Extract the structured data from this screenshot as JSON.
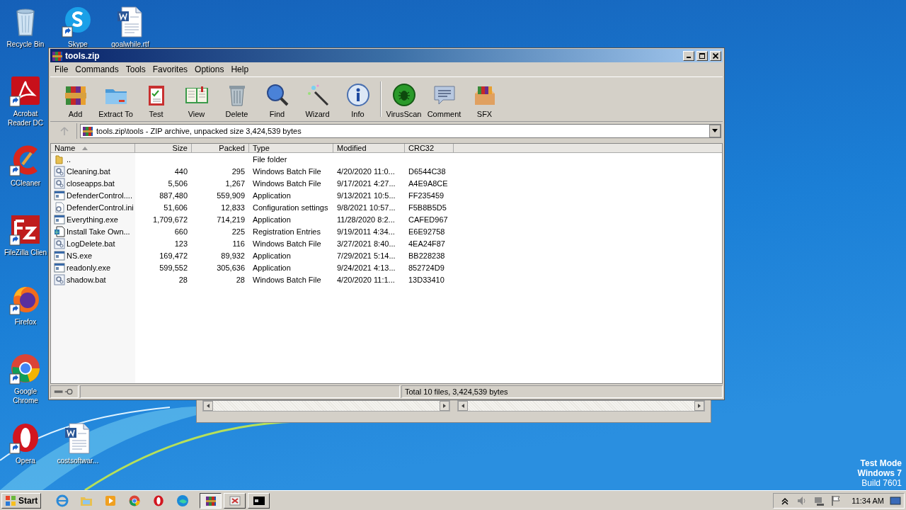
{
  "desktop": {
    "icons": [
      {
        "label": "Recycle Bin",
        "kind": "recycle",
        "shortcut": false
      },
      {
        "label": "Skype",
        "kind": "skype",
        "shortcut": true
      },
      {
        "label": "goalwhile.rtf",
        "kind": "word",
        "shortcut": false
      },
      {
        "label": "Acrobat Reader DC",
        "kind": "acrobat",
        "shortcut": true
      },
      {
        "label": "CCleaner",
        "kind": "ccleaner",
        "shortcut": true
      },
      {
        "label": "FileZilla Clien",
        "kind": "filezilla",
        "shortcut": true
      },
      {
        "label": "Firefox",
        "kind": "firefox",
        "shortcut": true
      },
      {
        "label": "Google Chrome",
        "kind": "chrome",
        "shortcut": true
      },
      {
        "label": "Opera",
        "kind": "opera",
        "shortcut": true
      },
      {
        "label": "costsoftwar...",
        "kind": "word",
        "shortcut": false
      }
    ],
    "notice": [
      "Test Mode",
      "Windows 7",
      "Build 7601"
    ]
  },
  "window": {
    "title": "tools.zip",
    "menu": [
      "File",
      "Commands",
      "Tools",
      "Favorites",
      "Options",
      "Help"
    ],
    "toolbar": {
      "groups": [
        [
          {
            "label": "Add",
            "kind": "add"
          },
          {
            "label": "Extract To",
            "kind": "extract"
          },
          {
            "label": "Test",
            "kind": "test"
          },
          {
            "label": "View",
            "kind": "view"
          },
          {
            "label": "Delete",
            "kind": "delete"
          },
          {
            "label": "Find",
            "kind": "find"
          },
          {
            "label": "Wizard",
            "kind": "wizard"
          },
          {
            "label": "Info",
            "kind": "info"
          }
        ],
        [
          {
            "label": "VirusScan",
            "kind": "virus"
          },
          {
            "label": "Comment",
            "kind": "comment"
          },
          {
            "label": "SFX",
            "kind": "sfx"
          }
        ]
      ]
    },
    "address": {
      "up_disabled": true,
      "value": "tools.zip\\tools - ZIP archive, unpacked size 3,424,539 bytes"
    },
    "table": {
      "columns": [
        {
          "label": "Name",
          "sorted": true
        },
        {
          "label": "Size",
          "sorted": false
        },
        {
          "label": "Packed",
          "sorted": false
        },
        {
          "label": "Type",
          "sorted": false
        },
        {
          "label": "Modified",
          "sorted": false
        },
        {
          "label": "CRC32",
          "sorted": false
        }
      ],
      "rows": [
        {
          "kind": "folder",
          "cells": [
            "..",
            "",
            "",
            "File folder",
            "",
            ""
          ]
        },
        {
          "kind": "bat",
          "cells": [
            "Cleaning.bat",
            "440",
            "295",
            "Windows Batch File",
            "4/20/2020 11:0...",
            "D6544C38"
          ]
        },
        {
          "kind": "bat",
          "cells": [
            "closeapps.bat",
            "5,506",
            "1,267",
            "Windows Batch File",
            "9/17/2021 4:27...",
            "A4E9A8CE"
          ]
        },
        {
          "kind": "exe",
          "cells": [
            "DefenderControl....",
            "887,480",
            "559,909",
            "Application",
            "9/13/2021 10:5...",
            "FF235459"
          ]
        },
        {
          "kind": "ini",
          "cells": [
            "DefenderControl.ini",
            "51,606",
            "12,833",
            "Configuration settings",
            "9/8/2021 10:57...",
            "F5B8B5D5"
          ]
        },
        {
          "kind": "exe",
          "cells": [
            "Everything.exe",
            "1,709,672",
            "714,219",
            "Application",
            "11/28/2020 8:2...",
            "CAFED967"
          ]
        },
        {
          "kind": "reg",
          "cells": [
            "Install Take Own...",
            "660",
            "225",
            "Registration Entries",
            "9/19/2011 4:34...",
            "E6E92758"
          ]
        },
        {
          "kind": "bat",
          "cells": [
            "LogDelete.bat",
            "123",
            "116",
            "Windows Batch File",
            "3/27/2021 8:40...",
            "4EA24F87"
          ]
        },
        {
          "kind": "exe",
          "cells": [
            "NS.exe",
            "169,472",
            "89,932",
            "Application",
            "7/29/2021 5:14...",
            "BB228238"
          ]
        },
        {
          "kind": "exe",
          "cells": [
            "readonly.exe",
            "599,552",
            "305,636",
            "Application",
            "9/24/2021 4:13...",
            "852724D9"
          ]
        },
        {
          "kind": "bat",
          "cells": [
            "shadow.bat",
            "28",
            "28",
            "Windows Batch File",
            "4/20/2020 11:1...",
            "13D33410"
          ]
        }
      ]
    },
    "status_bar": {
      "text": "Total 10 files, 3,424,539 bytes"
    }
  },
  "taskbar": {
    "start": "Start",
    "pinned": [
      {
        "kind": "ie"
      },
      {
        "kind": "explorer"
      },
      {
        "kind": "media"
      },
      {
        "kind": "chrome"
      },
      {
        "kind": "opera"
      },
      {
        "kind": "edge"
      }
    ],
    "tasks": [
      {
        "kind": "winrar",
        "selected": true
      },
      {
        "kind": "app",
        "selected": false
      },
      {
        "kind": "cmd",
        "selected": false
      }
    ],
    "tray": {
      "clock": "11:34 AM"
    }
  }
}
